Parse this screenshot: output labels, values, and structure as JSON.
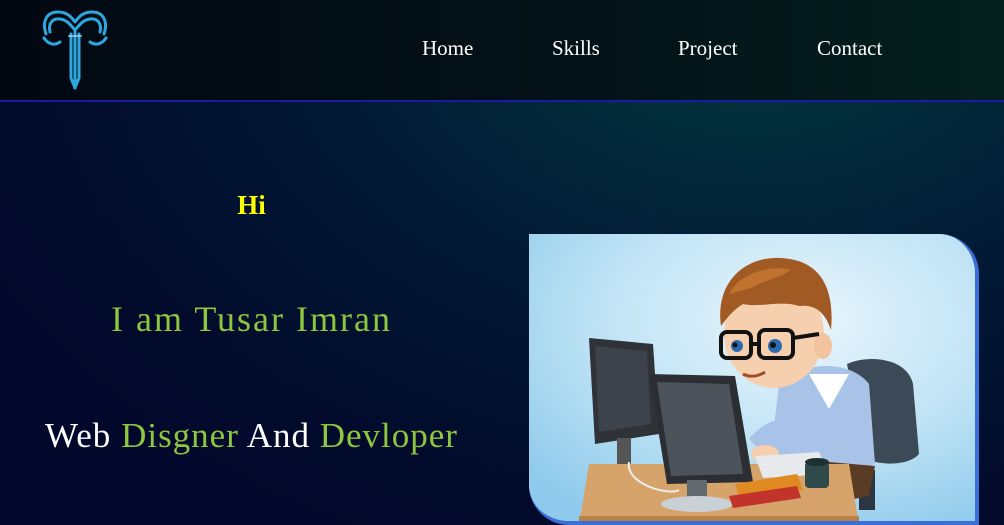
{
  "nav": {
    "logo_icon": "t-monogram-logo-icon",
    "links": [
      "Home",
      "Skills",
      "Project",
      "Contact"
    ]
  },
  "hero": {
    "greeting": "Hi",
    "intro": "I am Tusar Imran",
    "role": {
      "part1": "Web",
      "part2": "Disgner",
      "part3": "And",
      "part4": "Devloper"
    },
    "illustration_icon": "developer-at-computer-illustration"
  },
  "colors": {
    "accent_green": "#8dc63f",
    "greeting_yellow": "#ffff00",
    "nav_border": "#1a1aa6"
  }
}
